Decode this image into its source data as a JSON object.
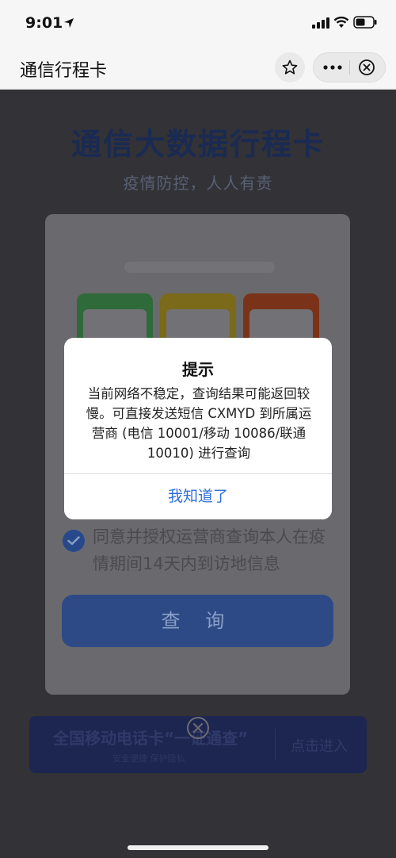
{
  "status_bar": {
    "time": "9:01",
    "location_icon": "location-arrow-icon",
    "signal_icon": "cellular-signal-icon",
    "wifi_icon": "wifi-icon",
    "battery_icon": "battery-icon"
  },
  "nav": {
    "title": "通信行程卡",
    "star_icon": "star-icon",
    "more_icon": "more-dots-icon",
    "close_icon": "close-circle-icon"
  },
  "page": {
    "hero_title": "通信大数据行程卡",
    "hero_subtitle": "疫情防控，人人有责"
  },
  "modal": {
    "agree_text": "同意并授权运营商查询本人在疫情期间14天内到访地信息",
    "query_button": "查 询"
  },
  "banner": {
    "title": "全国移动电话卡“一证通查”",
    "subtitle": "安全便捷 保护隐私",
    "enter": "点击进入"
  },
  "alert": {
    "title": "提示",
    "body": "当前网络不稳定，查询结果可能返回较慢。可直接发送短信 CXMYD 到所属运营商 (电信 10001/移动 10086/联通 10010) 进行查询",
    "button": "我知道了"
  },
  "colors": {
    "accent_blue": "#2f6fd8",
    "overlay": "#1e1e21"
  }
}
